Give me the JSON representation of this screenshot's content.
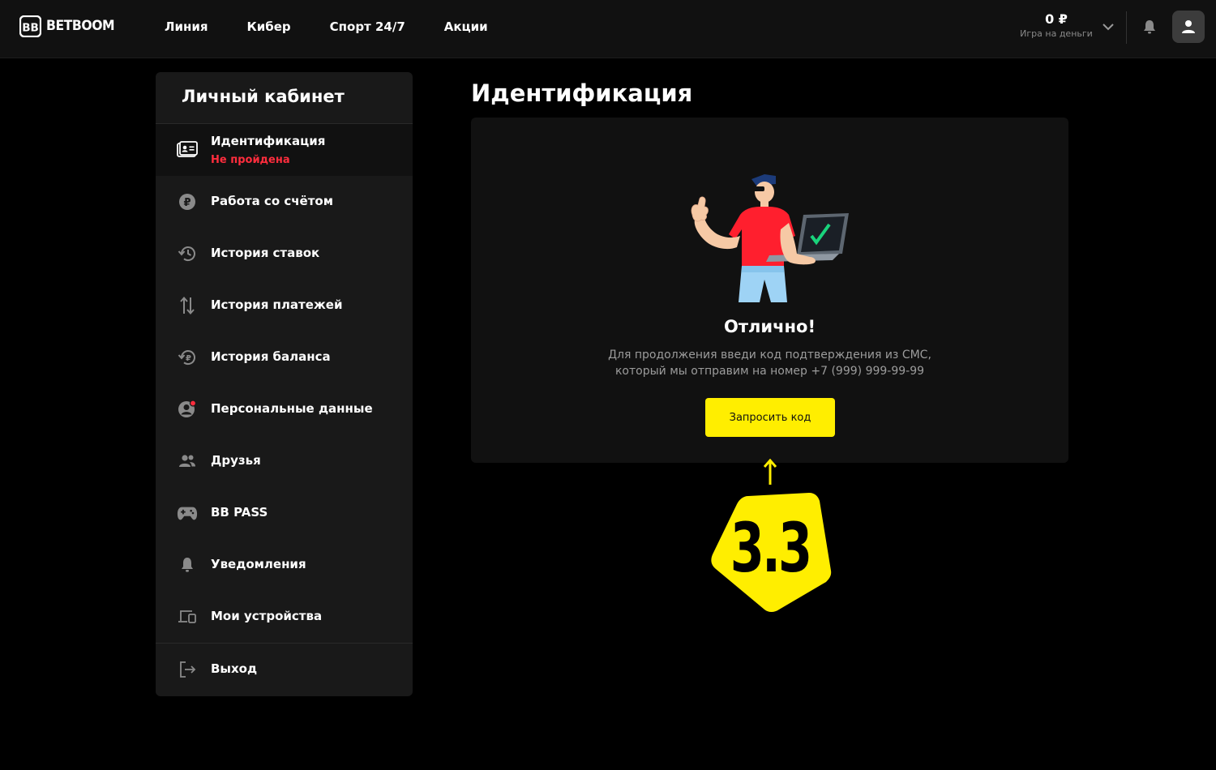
{
  "header": {
    "logo_text": "BETBOOM",
    "nav": [
      {
        "label": "Линия"
      },
      {
        "label": "Кибер"
      },
      {
        "label": "Спорт 24/7"
      },
      {
        "label": "Акции"
      }
    ],
    "balance_amount": "0 ₽",
    "balance_label": "Игра на деньги"
  },
  "sidebar": {
    "title": "Личный кабинет",
    "identification": {
      "label": "Идентификация",
      "status": "Не пройдена",
      "icon": "id-card-icon"
    },
    "items": [
      {
        "label": "Работа со счётом",
        "icon": "ruble-coin-icon"
      },
      {
        "label": "История ставок",
        "icon": "history-icon"
      },
      {
        "label": "История платежей",
        "icon": "transfer-arrows-icon"
      },
      {
        "label": "История баланса",
        "icon": "ruble-history-icon"
      },
      {
        "label": "Персональные данные",
        "icon": "person-icon"
      },
      {
        "label": "Друзья",
        "icon": "friends-icon"
      },
      {
        "label": "BB PASS",
        "icon": "gamepad-icon"
      },
      {
        "label": "Уведомления",
        "icon": "bell-icon"
      },
      {
        "label": "Мои устройства",
        "icon": "devices-icon"
      }
    ],
    "logout": {
      "label": "Выход",
      "icon": "logout-icon"
    }
  },
  "main": {
    "title": "Идентификация",
    "card": {
      "heading": "Отлично!",
      "text_line1": "Для продолжения введи код подтверждения из СМС,",
      "text_line2": "который мы отправим на номер +7 (999) 999-99-99",
      "button_label": "Запросить код"
    },
    "annotation": {
      "label": "3.3"
    }
  },
  "colors": {
    "accent": "#ffee00",
    "status_error": "#ff2d3d",
    "background": "#000000",
    "panel": "#191919",
    "header": "#111111"
  }
}
